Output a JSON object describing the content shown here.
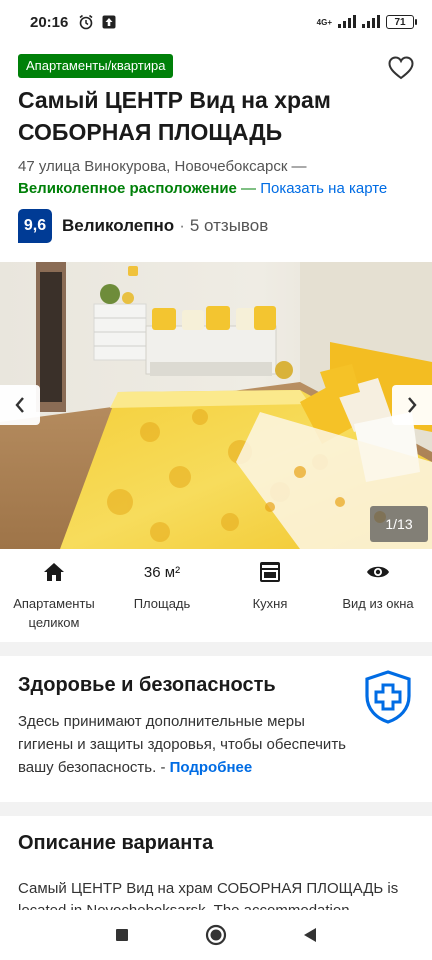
{
  "status_bar": {
    "time": "20:16",
    "network": "4G+",
    "battery": "71"
  },
  "listing": {
    "type_badge": "Апартаменты/квартира",
    "title": "Самый ЦЕНТР Вид на храм СОБОРНАЯ ПЛОЩАДЬ",
    "address": "47 улица Винокурова, Новочебоксарск —",
    "location_rating": "Великолепное расположение",
    "location_dash": " — ",
    "map_link": "Показать на карте",
    "favorite_icon": "heart-outline-icon"
  },
  "rating": {
    "score": "9,6",
    "word": "Великолепно",
    "separator": "·",
    "reviews": "5 отзывов"
  },
  "gallery": {
    "counter": "1/13",
    "prev_icon": "chevron-left-icon",
    "next_icon": "chevron-right-icon"
  },
  "facilities": [
    {
      "icon": "home-icon",
      "value": "",
      "label": "Апартаменты целиком"
    },
    {
      "icon": "",
      "value": "36 м²",
      "label": "Площадь"
    },
    {
      "icon": "kitchen-icon",
      "value": "",
      "label": "Кухня"
    },
    {
      "icon": "eye-icon",
      "value": "",
      "label": "Вид из окна"
    }
  ],
  "health": {
    "title": "Здоровье и безопасность",
    "text": "Здесь принимают дополнительные меры гигиены и защиты здоровья, чтобы обеспечить вашу безопасность. - ",
    "link": "Подробнее",
    "icon": "medical-shield-icon"
  },
  "description": {
    "title": "Описание варианта",
    "text": "Самый ЦЕНТР Вид на храм СОБОРНАЯ ПЛОЩАДЬ is located in Novocheboksarsk. The accommodation"
  },
  "colors": {
    "badge_green": "#008009",
    "score_blue": "#003b95",
    "link_blue": "#006ce4"
  }
}
